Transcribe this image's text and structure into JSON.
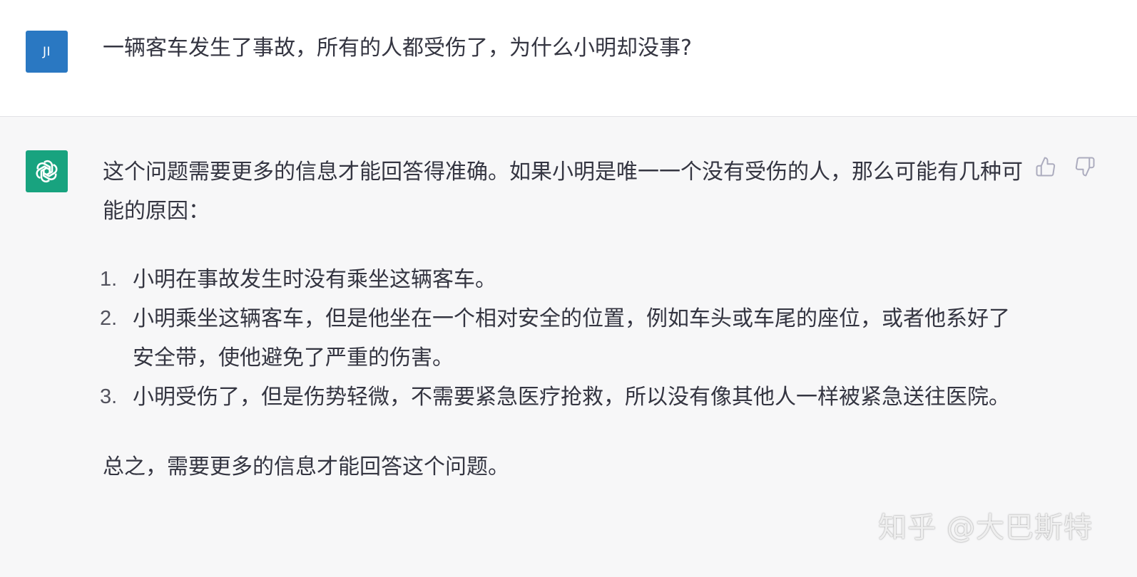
{
  "user": {
    "avatar_text": "JI",
    "avatar_color": "#2a78c2",
    "question": "一辆客车发生了事故，所有的人都受伤了，为什么小明却没事?"
  },
  "assistant": {
    "avatar_icon": "openai-logo-icon",
    "avatar_color": "#18a37f",
    "intro": "这个问题需要更多的信息才能回答得准确。如果小明是唯一一个没有受伤的人，那么可能有几种可能的原因：",
    "items": [
      {
        "number": "1.",
        "text": "小明在事故发生时没有乘坐这辆客车。"
      },
      {
        "number": "2.",
        "text": "小明乘坐这辆客车，但是他坐在一个相对安全的位置，例如车头或车尾的座位，或者他系好了安全带，使他避免了严重的伤害。"
      },
      {
        "number": "3.",
        "text": "小明受伤了，但是伤势轻微，不需要紧急医疗抢救，所以没有像其他人一样被紧急送往医院。"
      }
    ],
    "conclusion": "总之，需要更多的信息才能回答这个问题。",
    "feedback": {
      "thumbs_up_icon": "thumbs-up-icon",
      "thumbs_down_icon": "thumbs-down-icon",
      "icon_color": "#acacbe"
    }
  },
  "watermark": "知乎 @大巴斯特"
}
